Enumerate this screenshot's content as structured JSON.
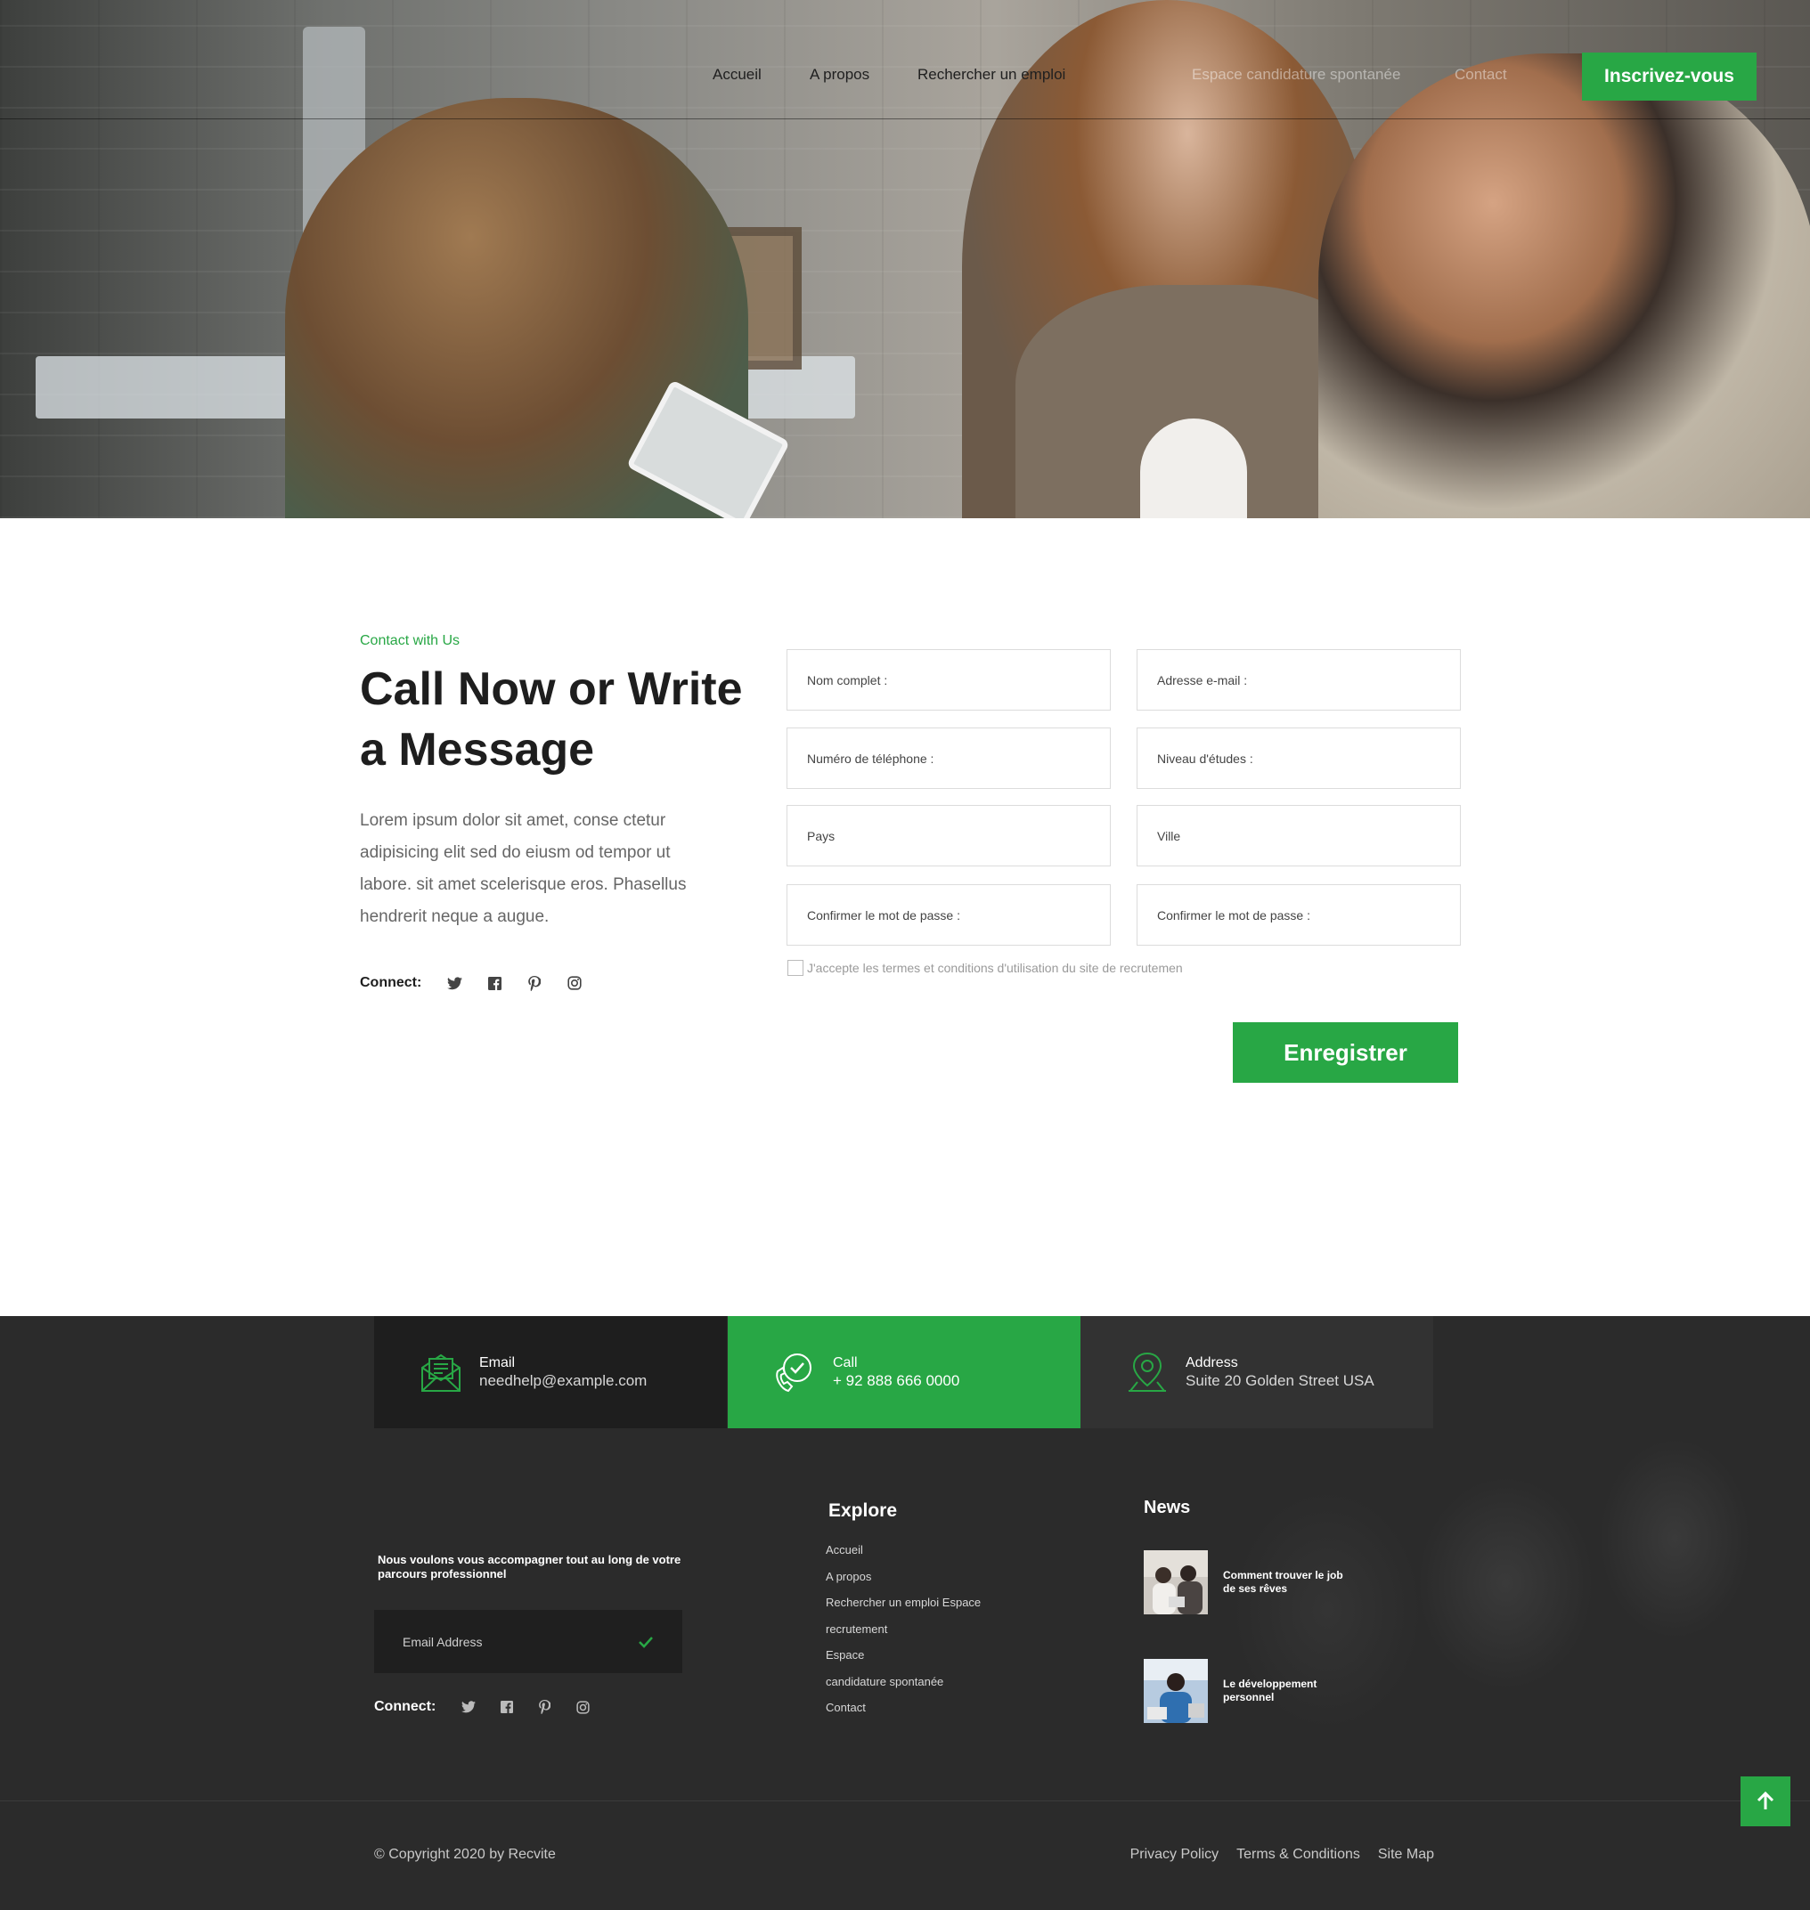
{
  "nav": {
    "items": [
      "Accueil",
      "A propos",
      "Rechercher un emploi",
      "Espace candidature spontanée",
      "Contact"
    ],
    "cta": "Inscrivez-vous"
  },
  "contact": {
    "eyebrow": "Contact with Us",
    "heading": "Call Now or Write a Message",
    "body": "Lorem ipsum dolor sit amet, conse ctetur adipisicing elit sed do eiusm od tempor ut labore. sit amet scelerisque eros. Phasellus hendrerit neque a augue.",
    "connect_label": "Connect:",
    "social_icons": [
      "twitter-icon",
      "facebook-icon",
      "pinterest-icon",
      "instagram-icon"
    ]
  },
  "form": {
    "fields": [
      {
        "placeholder": "Nom complet :"
      },
      {
        "placeholder": "Adresse e-mail :"
      },
      {
        "placeholder": "Numéro de téléphone :"
      },
      {
        "placeholder": "Niveau d'études :"
      },
      {
        "placeholder": "Pays"
      },
      {
        "placeholder": "Ville"
      },
      {
        "placeholder": "Confirmer le mot de passe :"
      },
      {
        "placeholder": "Confirmer le mot de passe :"
      }
    ],
    "terms": "J'accepte les termes et conditions d'utilisation du site de recrutemen",
    "submit": "Enregistrer"
  },
  "info_cards": [
    {
      "title": "Email",
      "value": "needhelp@example.com",
      "icon": "envelope-icon"
    },
    {
      "title": "Call",
      "value": "+ 92 888 666 0000",
      "icon": "phone-icon"
    },
    {
      "title": "Address",
      "value": "Suite 20 Golden Street USA",
      "icon": "map-pin-icon"
    }
  ],
  "footer": {
    "tagline": "Nous voulons vous accompagner tout au long de votre parcours professionnel",
    "email_placeholder": "Email Address",
    "connect_label": "Connect:",
    "explore_title": "Explore",
    "explore_links": [
      "Accueil",
      "A propos",
      "Rechercher un emploi Espace",
      "recrutement",
      "Espace",
      "candidature spontanée",
      "Contact"
    ],
    "news_title": "News",
    "news": [
      {
        "title": "Comment trouver le job de ses rêves"
      },
      {
        "title": "Le développement personnel"
      }
    ],
    "copyright": "© Copyright 2020 by Recvite",
    "bottom_links": [
      "Privacy Policy",
      "Terms & Conditions",
      "Site Map"
    ]
  },
  "colors": {
    "accent": "#28a745",
    "footer_bg": "#2b2b2b",
    "text_dark": "#1e1e1e"
  }
}
